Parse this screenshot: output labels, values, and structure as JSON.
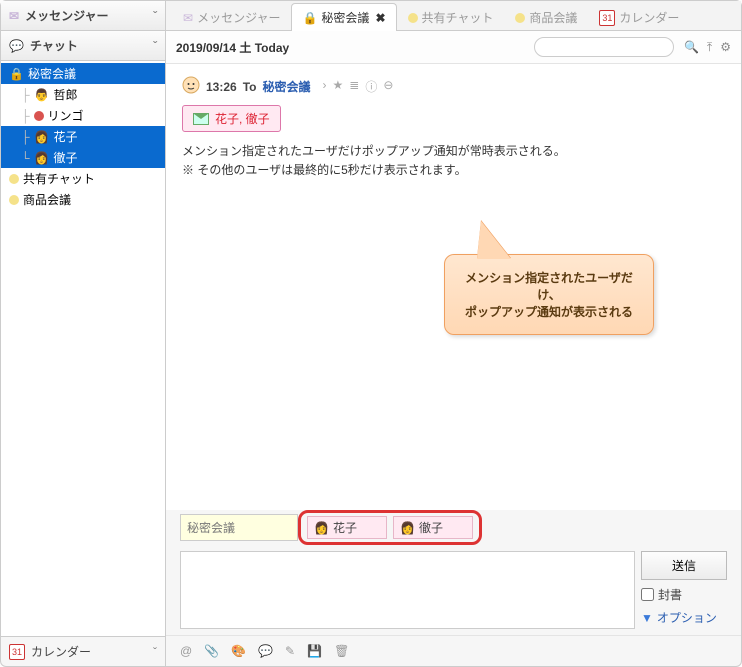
{
  "left": {
    "messenger": "メッセンジャー",
    "chat": "チャット",
    "tree": {
      "room": "秘密会議",
      "members": [
        "哲郎",
        "リンゴ",
        "花子",
        "徹子"
      ],
      "others": [
        "共有チャット",
        "商品会議"
      ]
    },
    "calendar": "カレンダー"
  },
  "tabs": {
    "items": [
      {
        "label": "メッセンジャー",
        "icon": "env"
      },
      {
        "label": "秘密会議",
        "icon": "lock",
        "closable": true,
        "active": true
      },
      {
        "label": "共有チャット",
        "icon": "dot"
      },
      {
        "label": "商品会議",
        "icon": "dot"
      },
      {
        "label": "カレンダー",
        "icon": "cal"
      }
    ]
  },
  "datebar": {
    "date": "2019/09/14 土 Today"
  },
  "msg": {
    "time": "13:26",
    "to": "To",
    "room": "秘密会議",
    "mention": "花子, 徹子",
    "line1": "メンション指定されたユーザだけポップアップ通知が常時表示される。",
    "line2": "※ その他のユーザは最終的に5秒だけ表示されます。"
  },
  "callout": {
    "line1": "メンション指定されたユーザだけ、",
    "line2": "ポップアップ通知が表示される"
  },
  "compose": {
    "room": "秘密会議",
    "recipients": [
      "花子",
      "徹子"
    ],
    "send": "送信",
    "sealed": "封書",
    "option": "オプション"
  },
  "cal31": "31"
}
